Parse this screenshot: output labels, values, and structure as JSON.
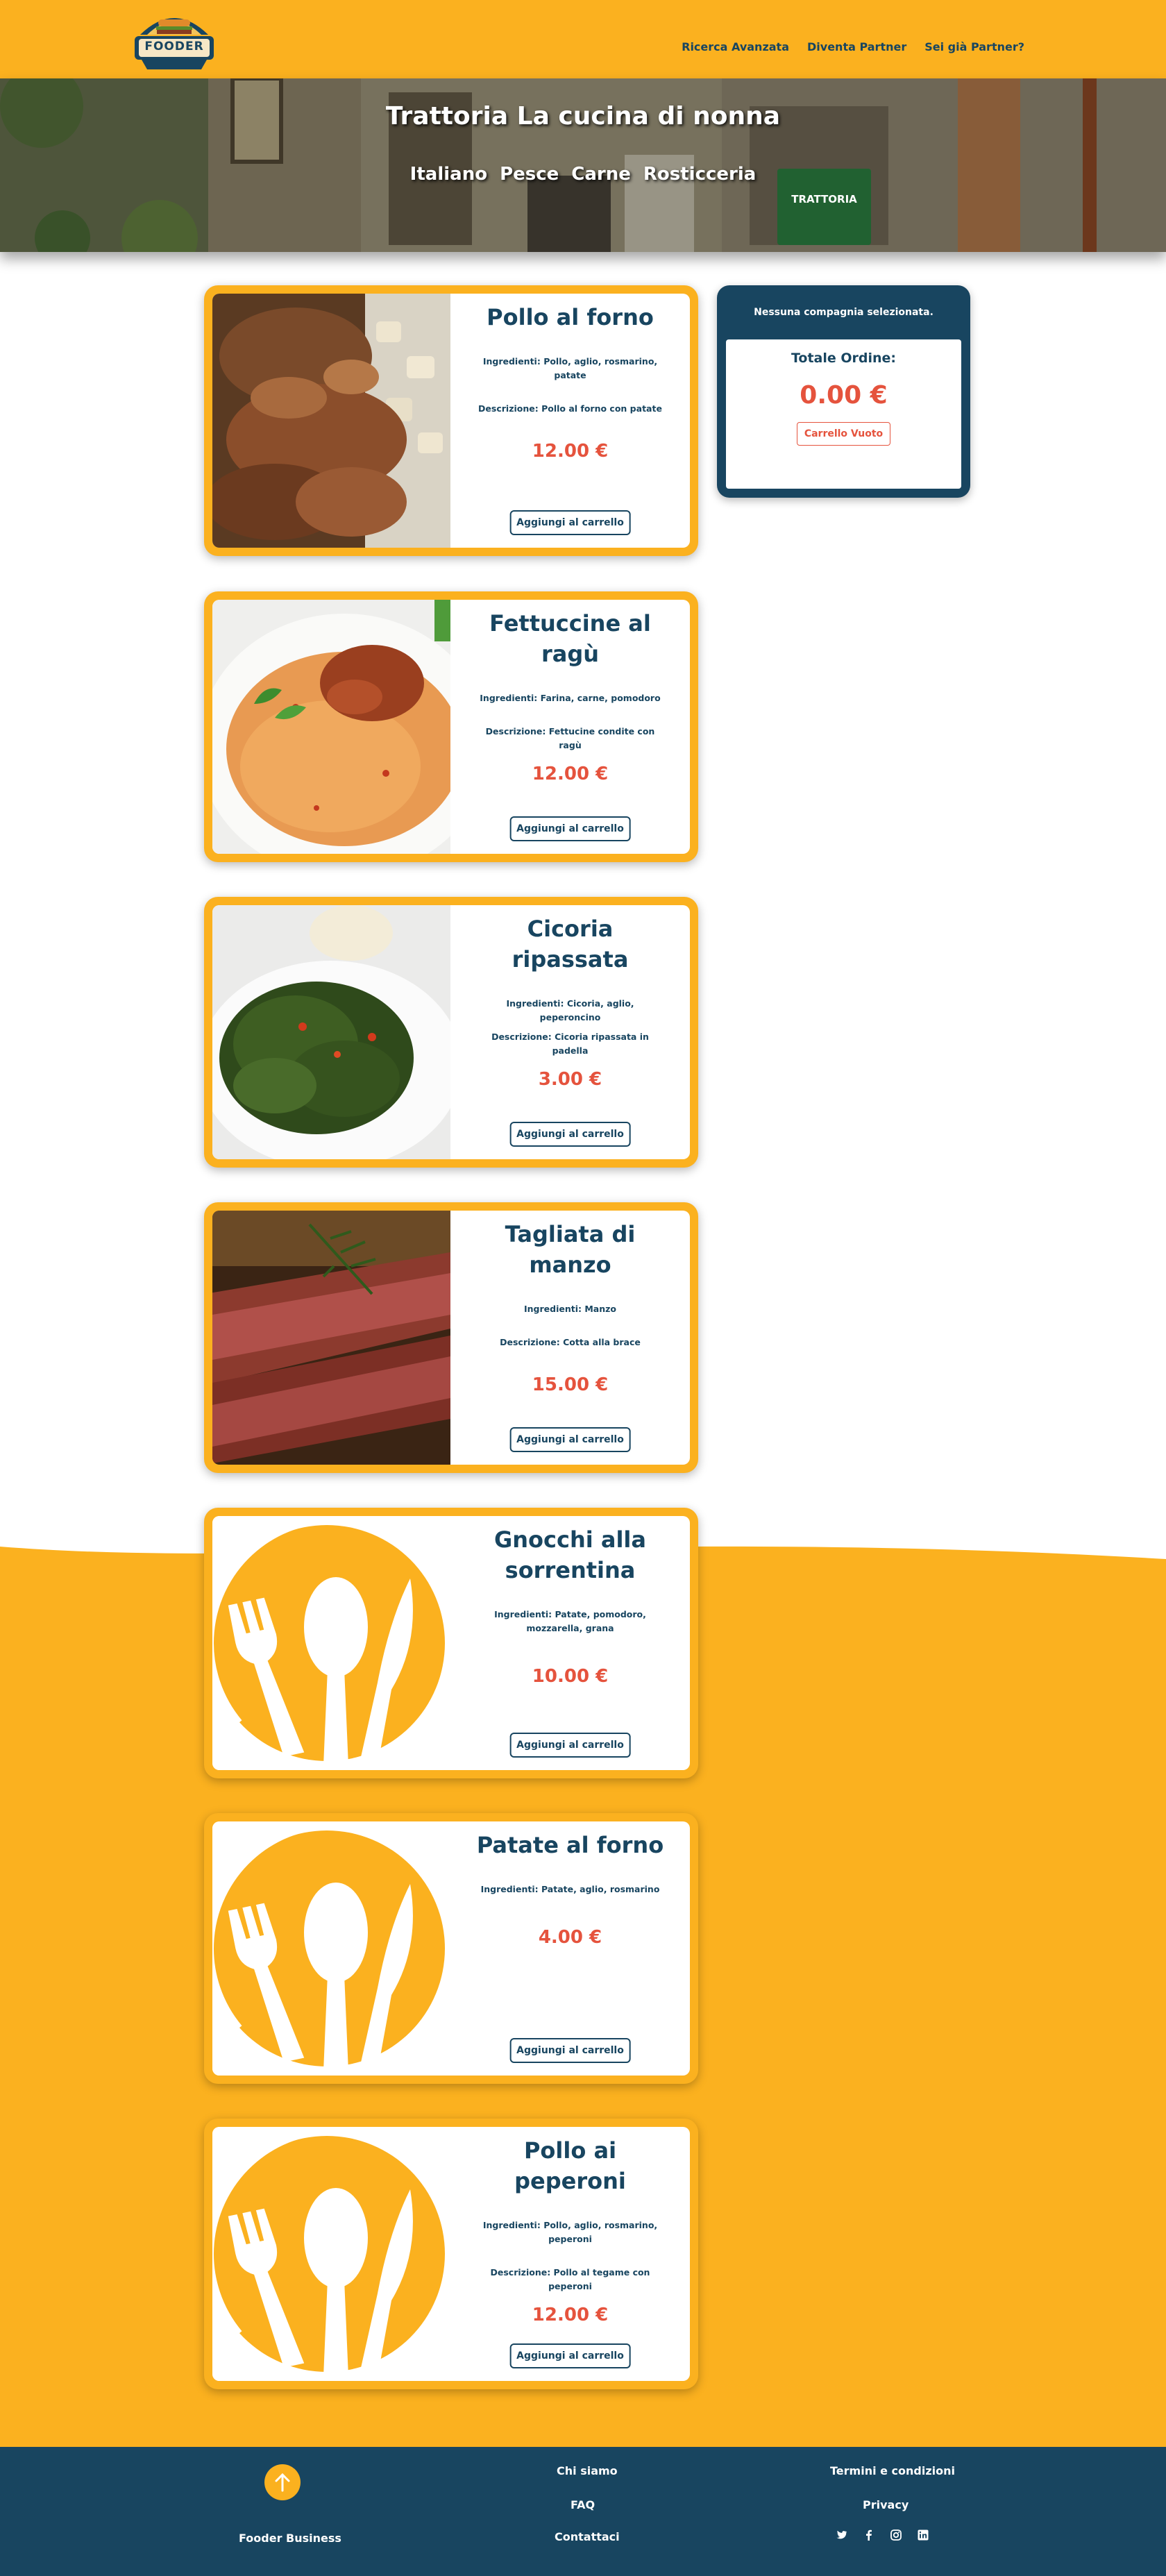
{
  "header": {
    "logo_text": "FOODER",
    "nav": [
      "Ricerca Avanzata",
      "Diventa Partner",
      "Sei già Partner?"
    ]
  },
  "hero": {
    "title": "Trattoria La cucina di nonna",
    "tags": [
      "Italiano",
      "Pesce",
      "Carne",
      "Rosticceria"
    ],
    "sign_text": "TRATTORIA"
  },
  "dishes": [
    {
      "name": "Pollo al forno",
      "ingredients": "Ingredienti: Pollo, aglio, rosmarino, patate",
      "description": "Descrizione: Pollo al forno con patate",
      "price": "12.00 €",
      "button": "Aggiungi al carrello",
      "image": "roast-chicken-photo"
    },
    {
      "name": "Fettuccine al ragù",
      "ingredients": "Ingredienti: Farina, carne, pomodoro",
      "description": "Descrizione: Fettucine condite con ragù",
      "price": "12.00 €",
      "button": "Aggiungi al carrello",
      "image": "pasta-photo"
    },
    {
      "name": "Cicoria ripassata",
      "ingredients": "Ingredienti: Cicoria, aglio, peperoncino",
      "description": "Descrizione: Cicoria ripassata in padella",
      "price": "3.00 €",
      "button": "Aggiungi al carrello",
      "image": "chicory-photo"
    },
    {
      "name": "Tagliata di manzo",
      "ingredients": "Ingredienti: Manzo",
      "description": "Descrizione: Cotta alla brace",
      "price": "15.00 €",
      "button": "Aggiungi al carrello",
      "image": "steak-photo"
    },
    {
      "name": "Gnocchi alla sorrentina",
      "ingredients": "Ingredienti: Patate, pomodoro, mozzarella, grana",
      "description": "",
      "price": "10.00 €",
      "button": "Aggiungi al carrello",
      "image": "cutlery-placeholder-icon"
    },
    {
      "name": "Patate al forno",
      "ingredients": "Ingredienti: Patate, aglio, rosmarino",
      "description": "",
      "price": "4.00 €",
      "button": "Aggiungi al carrello",
      "image": "cutlery-placeholder-icon"
    },
    {
      "name": "Pollo ai peperoni",
      "ingredients": "Ingredienti: Pollo, aglio, rosmarino, peperoni",
      "description": "Descrizione: Pollo al tegame con peperoni",
      "price": "12.00 €",
      "button": "Aggiungi al carrello",
      "image": "cutlery-placeholder-icon"
    }
  ],
  "cart": {
    "status": "Nessuna compagnia selezionata.",
    "total_label": "Totale Ordine:",
    "total": "0.00 €",
    "empty_button": "Carrello Vuoto"
  },
  "footer": {
    "business": "Fooder Business",
    "links_center": [
      "Chi siamo",
      "FAQ",
      "Contattaci"
    ],
    "links_right": [
      "Termini e condizioni",
      "Privacy"
    ],
    "social_icons": [
      "twitter-icon",
      "facebook-icon",
      "instagram-icon",
      "linkedin-icon"
    ]
  },
  "colors": {
    "accent": "#fbb11f",
    "navy": "#184560",
    "price": "#e5533d"
  }
}
